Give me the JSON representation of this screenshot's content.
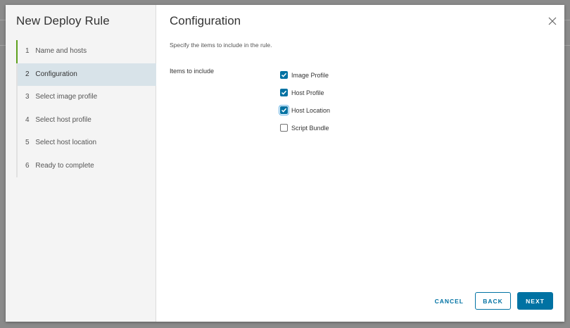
{
  "wizard": {
    "title": "New Deploy Rule",
    "steps": [
      {
        "num": "1",
        "label": "Name and hosts",
        "state": "done"
      },
      {
        "num": "2",
        "label": "Configuration",
        "state": "active"
      },
      {
        "num": "3",
        "label": "Select image profile",
        "state": "pending"
      },
      {
        "num": "4",
        "label": "Select host profile",
        "state": "pending"
      },
      {
        "num": "5",
        "label": "Select host location",
        "state": "pending"
      },
      {
        "num": "6",
        "label": "Ready to complete",
        "state": "pending"
      }
    ]
  },
  "page": {
    "title": "Configuration",
    "instruction": "Specify the items to include in the rule.",
    "field_label": "Items to include",
    "options": [
      {
        "label": "Image Profile",
        "checked": true
      },
      {
        "label": "Host Profile",
        "checked": true
      },
      {
        "label": "Host Location",
        "checked": true
      },
      {
        "label": "Script Bundle",
        "checked": false
      }
    ]
  },
  "footer": {
    "cancel_label": "CANCEL",
    "back_label": "BACK",
    "next_label": "NEXT"
  },
  "icons": {
    "close": "close-icon",
    "check": "check-icon"
  },
  "colors": {
    "accent": "#0072a3",
    "completed_step": "#5ea11d",
    "active_step_bg": "#d8e3e9"
  }
}
